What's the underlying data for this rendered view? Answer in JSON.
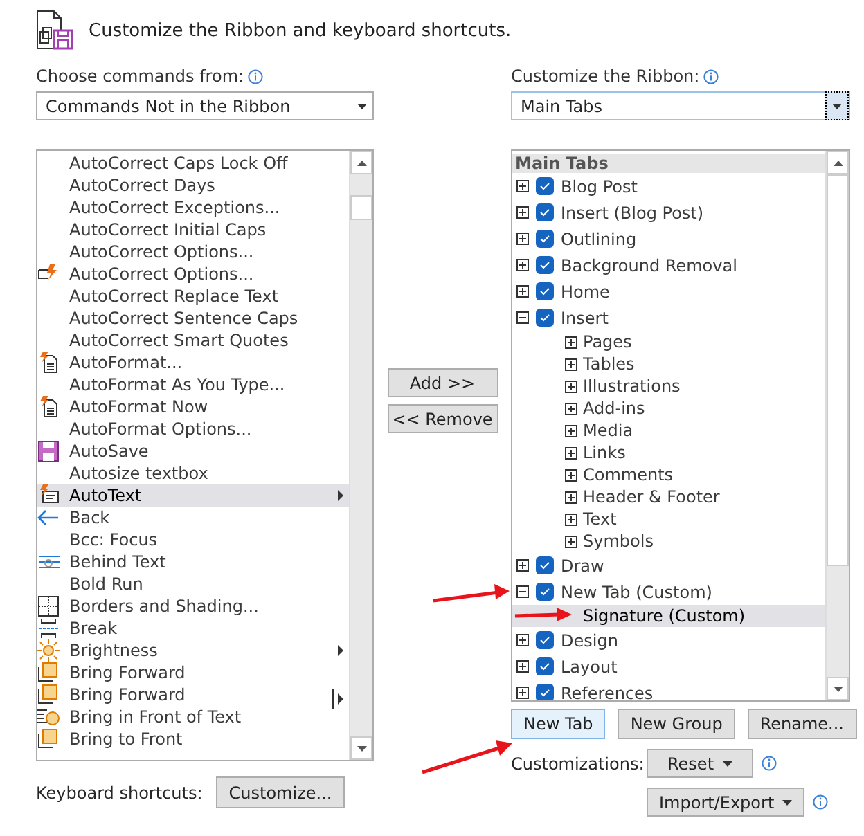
{
  "header": {
    "title": "Customize the Ribbon and keyboard shortcuts."
  },
  "commands_source": {
    "label": "Choose commands from:",
    "value": "Commands Not in the Ribbon",
    "focused": false
  },
  "commands": [
    {
      "label": "AutoCorrect Caps Lock Off",
      "kind": "plain",
      "selected": false
    },
    {
      "label": "AutoCorrect Days",
      "kind": "plain",
      "selected": false
    },
    {
      "label": "AutoCorrect Exceptions...",
      "kind": "plain",
      "selected": false
    },
    {
      "label": "AutoCorrect Initial Caps",
      "kind": "plain",
      "selected": false
    },
    {
      "label": "AutoCorrect Options...",
      "kind": "plain",
      "selected": false
    },
    {
      "label": "AutoCorrect Options...",
      "kind": "bolt",
      "selected": false
    },
    {
      "label": "AutoCorrect Replace Text",
      "kind": "plain",
      "selected": false
    },
    {
      "label": "AutoCorrect Sentence Caps",
      "kind": "plain",
      "selected": false
    },
    {
      "label": "AutoCorrect Smart Quotes",
      "kind": "plain",
      "selected": false
    },
    {
      "label": "AutoFormat...",
      "kind": "boltdoc",
      "selected": false
    },
    {
      "label": "AutoFormat As You Type...",
      "kind": "plain",
      "selected": false
    },
    {
      "label": "AutoFormat Now",
      "kind": "boltdoc",
      "selected": false
    },
    {
      "label": "AutoFormat Options...",
      "kind": "plain",
      "selected": false
    },
    {
      "label": "AutoSave",
      "kind": "save",
      "selected": false
    },
    {
      "label": "Autosize textbox",
      "kind": "plain",
      "selected": false
    },
    {
      "label": "AutoText",
      "kind": "autotext",
      "submenu": true,
      "selected": true
    },
    {
      "label": "Back",
      "kind": "back",
      "selected": false
    },
    {
      "label": "Bcc: Focus",
      "kind": "plain",
      "selected": false
    },
    {
      "label": "Behind Text",
      "kind": "behind",
      "selected": false
    },
    {
      "label": "Bold Run",
      "kind": "plain",
      "selected": false
    },
    {
      "label": "Borders and Shading...",
      "kind": "borders",
      "selected": false
    },
    {
      "label": "Break",
      "kind": "break",
      "selected": false
    },
    {
      "label": "Brightness",
      "kind": "sun",
      "submenu": true,
      "selected": false
    },
    {
      "label": "Bring Forward",
      "kind": "forward",
      "selected": false
    },
    {
      "label": "Bring Forward",
      "kind": "forward",
      "submenu": true,
      "split": true,
      "selected": false
    },
    {
      "label": "Bring in Front of Text",
      "kind": "wraptext",
      "selected": false
    },
    {
      "label": "Bring to Front",
      "kind": "forward",
      "selected": false
    }
  ],
  "transfer_buttons": [
    {
      "label": "Add >>"
    },
    {
      "label": "<< Remove"
    }
  ],
  "keyboard_shortcuts": {
    "label": "Keyboard shortcuts:",
    "button": "Customize..."
  },
  "ribbon_target": {
    "label": "Customize the Ribbon:",
    "value": "Main Tabs",
    "focused": true
  },
  "ribbon_tree": {
    "heading": "Main Tabs",
    "items": [
      {
        "label": "Blog Post",
        "expanded": false,
        "checked": true,
        "selected": false
      },
      {
        "label": "Insert (Blog Post)",
        "expanded": false,
        "checked": true,
        "selected": false
      },
      {
        "label": "Outlining",
        "expanded": false,
        "checked": true,
        "selected": false
      },
      {
        "label": "Background Removal",
        "expanded": false,
        "checked": true,
        "selected": false
      },
      {
        "label": "Home",
        "expanded": false,
        "checked": true,
        "selected": false
      },
      {
        "label": "Insert",
        "expanded": true,
        "checked": true,
        "selected": false,
        "children": [
          {
            "label": "Pages",
            "kind": "group",
            "selected": false
          },
          {
            "label": "Tables",
            "kind": "group",
            "selected": false
          },
          {
            "label": "Illustrations",
            "kind": "group",
            "selected": false
          },
          {
            "label": "Add-ins",
            "kind": "group",
            "selected": false
          },
          {
            "label": "Media",
            "kind": "group",
            "selected": false
          },
          {
            "label": "Links",
            "kind": "group",
            "selected": false
          },
          {
            "label": "Comments",
            "kind": "group",
            "selected": false
          },
          {
            "label": "Header & Footer",
            "kind": "group",
            "selected": false
          },
          {
            "label": "Text",
            "kind": "group",
            "selected": false
          },
          {
            "label": "Symbols",
            "kind": "group",
            "selected": false
          }
        ]
      },
      {
        "label": "Draw",
        "expanded": false,
        "checked": true,
        "selected": false
      },
      {
        "label": "New Tab (Custom)",
        "expanded": true,
        "checked": true,
        "selected": false,
        "children": [
          {
            "label": "Signature (Custom)",
            "kind": "empty",
            "selected": true
          }
        ]
      },
      {
        "label": "Design",
        "expanded": false,
        "checked": true,
        "selected": false
      },
      {
        "label": "Layout",
        "expanded": false,
        "checked": true,
        "selected": false
      },
      {
        "label": "References",
        "expanded": false,
        "checked": true,
        "selected": false
      }
    ]
  },
  "tree_buttons": [
    {
      "label": "New Tab",
      "focused": true
    },
    {
      "label": "New Group",
      "focused": false
    },
    {
      "label": "Rename...",
      "focused": false
    }
  ],
  "customizations": {
    "label": "Customizations:",
    "reset": "Reset",
    "import_export": "Import/Export"
  }
}
